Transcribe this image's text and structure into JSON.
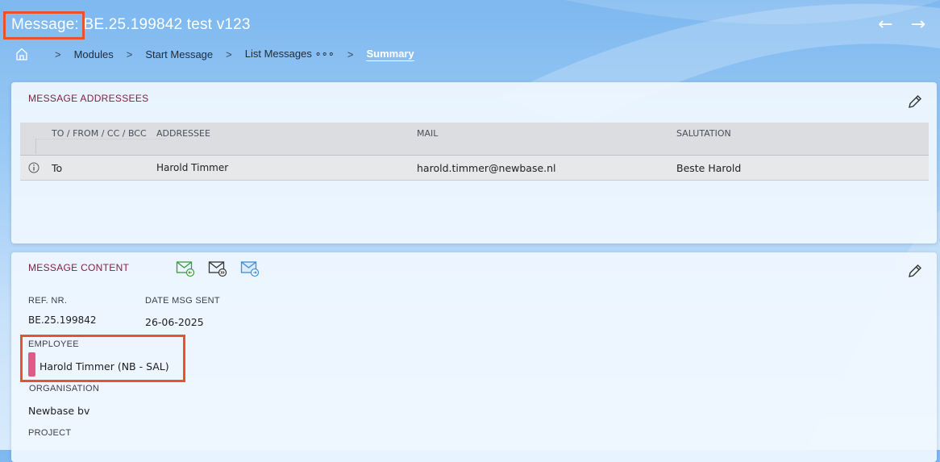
{
  "header": {
    "title_label": "Message:",
    "title_value": "BE.25.199842 test v123",
    "back_glyph": "←",
    "forward_glyph": "→"
  },
  "breadcrumb": {
    "home_icon": "home-icon",
    "items": [
      "Modules",
      "Start Message",
      "List Messages ∘∘∘",
      "Summary"
    ],
    "separator": ">"
  },
  "addressees": {
    "title": "MESSAGE ADDRESSEES",
    "edit_icon": "pencil-icon",
    "columns": [
      "TO / FROM / CC / BCC",
      "ADDRESSEE",
      "MAIL",
      "SALUTATION"
    ],
    "rows": [
      {
        "type": "To",
        "addressee": "Harold Timmer",
        "mail": "harold.timmer@newbase.nl",
        "salutation": "Beste Harold",
        "icon": "info-icon"
      }
    ]
  },
  "content": {
    "title": "MESSAGE CONTENT",
    "edit_icon": "pencil-icon",
    "mail_icons": [
      "mail-reply-icon",
      "mail-forward-all-icon",
      "mail-send-icon"
    ],
    "ref_label": "REF. NR.",
    "ref_value": "BE.25.199842",
    "date_label": "DATE MSG SENT",
    "date_value": "26-06-2025",
    "employee_label": "EMPLOYEE",
    "employee_value": "Harold Timmer (NB - SAL)",
    "organisation_label": "ORGANISATION",
    "organisation_value": "Newbase bv",
    "project_label": "PROJECT"
  },
  "colors": {
    "accent_title": "#7b1f3e",
    "highlight": "#e8532d",
    "employee_tag": "#e05b87"
  }
}
